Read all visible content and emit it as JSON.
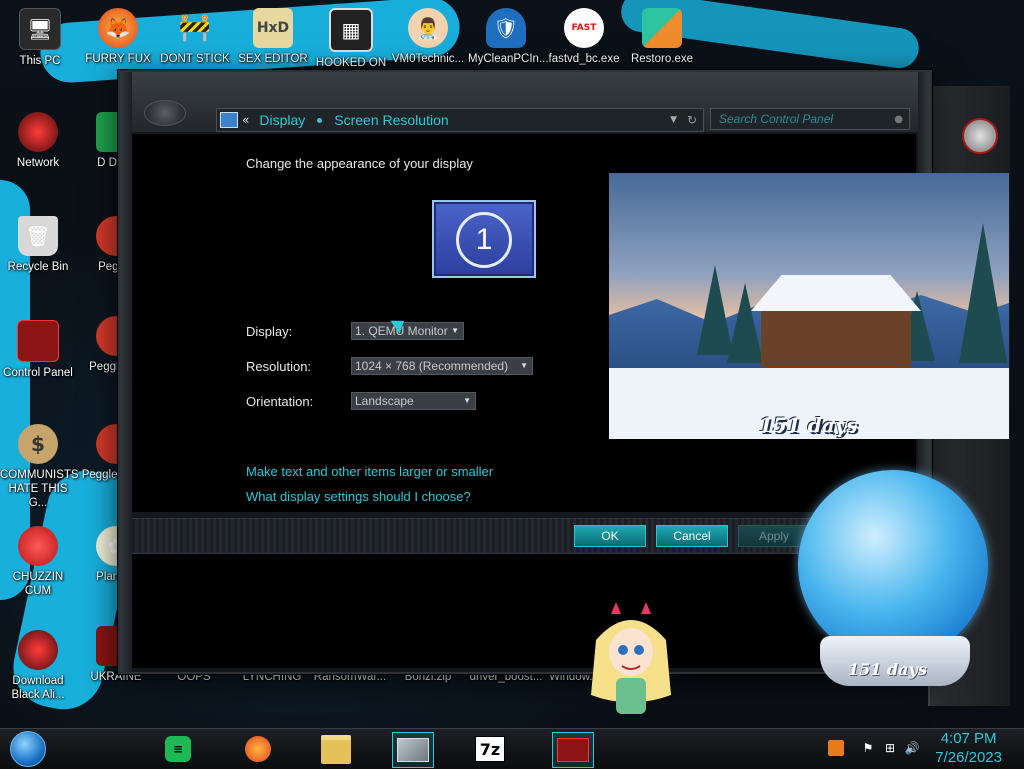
{
  "desktop": {
    "icons_top": [
      {
        "label": "This PC",
        "icon": "this-pc-icon"
      },
      {
        "label": "FURRY FUX",
        "icon": "firefox-icon"
      },
      {
        "label": "DONT STICK",
        "icon": "vlc-icon"
      },
      {
        "label": "SEX EDITOR",
        "icon": "hxd-icon"
      },
      {
        "label": "HOOKED ON",
        "icon": "maze-icon"
      },
      {
        "label": "VM0Technic...",
        "icon": "doctor-icon"
      },
      {
        "label": "MyCleanPCIn...",
        "icon": "shield-icon"
      },
      {
        "label": "fastvd_bc.exe",
        "icon": "fast-video-icon"
      },
      {
        "label": "Restoro.exe",
        "icon": "restoro-icon"
      }
    ],
    "icons_left": [
      {
        "label": "Network",
        "icon": "network-icon"
      },
      {
        "label": "Recycle Bin",
        "icon": "recycle-bin-icon"
      },
      {
        "label": "Control Panel",
        "icon": "control-panel-icon"
      },
      {
        "label": "COMMUNISTS HATE THIS G...",
        "icon": "money-bag-icon"
      },
      {
        "label": "CHUZZIN CUM",
        "icon": "chuzzle-icon"
      },
      {
        "label": "Download Black Ali...",
        "icon": "alien-icon"
      }
    ],
    "icons_col2": [
      {
        "label": "D DUM",
        "icon": "app-icon"
      },
      {
        "label": "Peggle",
        "icon": "peggle-icon"
      },
      {
        "label": "Peggle De",
        "icon": "peggle-icon"
      },
      {
        "label": "Peggle of Wa",
        "icon": "peggle-icon"
      },
      {
        "label": "Plan Zo",
        "icon": "plants-icon"
      }
    ],
    "icons_bottom": [
      {
        "label": "UKRAINE"
      },
      {
        "label": "OOPS"
      },
      {
        "label": "LYNCHING"
      },
      {
        "label": "RansomWar..."
      },
      {
        "label": "Bonzi.zip"
      },
      {
        "label": "driver_boost..."
      },
      {
        "label": "Window..."
      }
    ],
    "countdown_text": "151 days",
    "globe_text": "151 days"
  },
  "window": {
    "breadcrumb": [
      "Display",
      "Screen Resolution"
    ],
    "back_glyph": "«",
    "search_placeholder": "Search Control Panel",
    "heading": "Change the appearance of your display",
    "monitor_number": "1",
    "display_label": "Display:",
    "display_value": "1. QEMU Monitor",
    "resolution_label": "Resolution:",
    "resolution_value": "1024 × 768 (Recommended)",
    "orientation_label": "Orientation:",
    "orientation_value": "Landscape",
    "link_text_size": "Make text and other items larger or smaller",
    "link_help": "What display settings should I choose?",
    "ok_label": "OK",
    "cancel_label": "Cancel",
    "apply_label": "Apply"
  },
  "taskbar": {
    "apps": [
      {
        "name": "spotify-icon"
      },
      {
        "name": "firefox-icon"
      },
      {
        "name": "file-explorer-icon"
      },
      {
        "name": "display-settings-icon"
      },
      {
        "name": "7zip-icon",
        "text": "7z"
      },
      {
        "name": "alienware-gadget-icon"
      }
    ],
    "time": "4:07 PM",
    "date": "7/26/2023"
  },
  "colors": {
    "accent": "#2bc9d9",
    "wallpaper_stroke": "#19b7e6"
  }
}
